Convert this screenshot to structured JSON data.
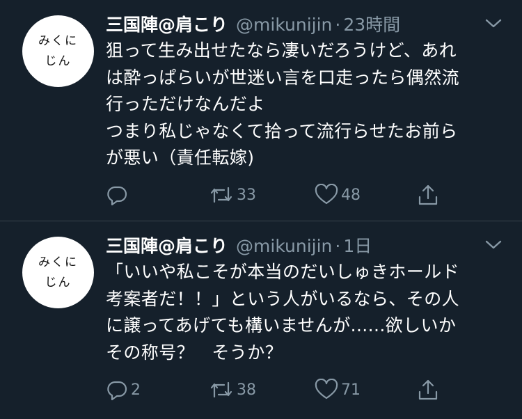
{
  "tweets": [
    {
      "avatar_text": "みくに\nじん",
      "name": "三国陣@肩こり",
      "handle": "@mikunijin",
      "time": "23時間",
      "lines": [
        "狙って生み出せたなら凄いだろうけど、あれ",
        "は酔っぱらいが世迷い言を口走ったら偶然流",
        "行っただけなんだよ",
        "つまり私じゃなくて拾って流行らせたお前ら",
        "が悪い（責任転嫁)"
      ],
      "reply_count": "",
      "retweet_count": "33",
      "like_count": "48"
    },
    {
      "avatar_text": "みくに\nじん",
      "name": "三国陣@肩こり",
      "handle": "@mikunijin",
      "time": "1日",
      "lines": [
        "「いいや私こそが本当のだいしゅきホールド",
        "考案者だ！！」という人がいるなら、その人",
        "に譲ってあげても構いませんが......欲しいか",
        "その称号？　そうか？"
      ],
      "reply_count": "2",
      "retweet_count": "38",
      "like_count": "71"
    }
  ],
  "separator": "·",
  "icons": [
    "chevron-down-icon",
    "reply-icon",
    "retweet-icon",
    "like-icon",
    "share-icon"
  ],
  "colors": {
    "background": "#15202b",
    "secondary_text": "#8899a6",
    "divider": "#38444d"
  }
}
